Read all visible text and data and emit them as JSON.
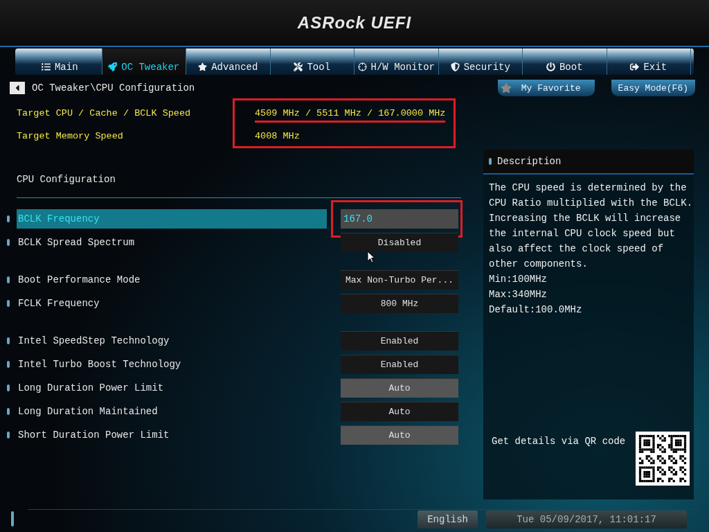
{
  "logo": "ASRock UEFI",
  "tabs": [
    {
      "label": "Main",
      "selected": false
    },
    {
      "label": "OC Tweaker",
      "selected": true
    },
    {
      "label": "Advanced",
      "selected": false
    },
    {
      "label": "Tool",
      "selected": false
    },
    {
      "label": "H/W Monitor",
      "selected": false
    },
    {
      "label": "Security",
      "selected": false
    },
    {
      "label": "Boot",
      "selected": false
    },
    {
      "label": "Exit",
      "selected": false
    }
  ],
  "breadcrumb": "OC Tweaker\\CPU Configuration",
  "favorite_button": "My Favorite",
  "easy_mode_button": "Easy Mode(F6)",
  "target_info": {
    "outlined": true,
    "rows": [
      {
        "label": "Target CPU / Cache / BCLK Speed",
        "value": "4509 MHz / 5511 MHz / 167.0000 MHz",
        "underlined": true
      },
      {
        "label": "Target Memory Speed",
        "value": "4008 MHz"
      }
    ]
  },
  "section_title": "CPU Configuration",
  "setting_groups": [
    [
      {
        "label": "BCLK Frequency",
        "value": "167.0",
        "kind": "input",
        "selected": true,
        "outlined": true
      },
      {
        "label": "BCLK Spread Spectrum",
        "value": "Disabled",
        "kind": "option",
        "selected": false,
        "hovered": false
      }
    ],
    [
      {
        "label": "Boot Performance Mode",
        "value": "Max Non-Turbo Per...",
        "kind": "option",
        "selected": false,
        "hovered": false
      },
      {
        "label": "FCLK Frequency",
        "value": "800 MHz",
        "kind": "option",
        "selected": false,
        "hovered": false
      }
    ],
    [
      {
        "label": "Intel SpeedStep Technology",
        "value": "Enabled",
        "kind": "option",
        "selected": false,
        "hovered": false
      },
      {
        "label": "Intel Turbo Boost Technology",
        "value": "Enabled",
        "kind": "option",
        "selected": false,
        "hovered": false
      },
      {
        "label": "Long Duration Power Limit",
        "value": "Auto",
        "kind": "option",
        "selected": false,
        "hovered": true
      },
      {
        "label": "Long Duration Maintained",
        "value": "Auto",
        "kind": "option",
        "selected": false,
        "hovered": false
      },
      {
        "label": "Short Duration Power Limit",
        "value": "Auto",
        "kind": "option",
        "selected": false,
        "hovered": true
      }
    ]
  ],
  "description": {
    "title": "Description",
    "lines": [
      "The CPU speed is determined by the",
      "CPU Ratio multiplied with the BCLK.",
      "Increasing the BCLK will increase",
      "the internal CPU clock speed but",
      "also affect the clock speed of",
      "other components.",
      "Min:100MHz",
      "Max:340MHz",
      "Default:100.0MHz"
    ],
    "qr_caption": "Get details via QR code"
  },
  "status_bar": {
    "language": "English",
    "datetime": "Tue 05/09/2017, 11:01:17"
  }
}
